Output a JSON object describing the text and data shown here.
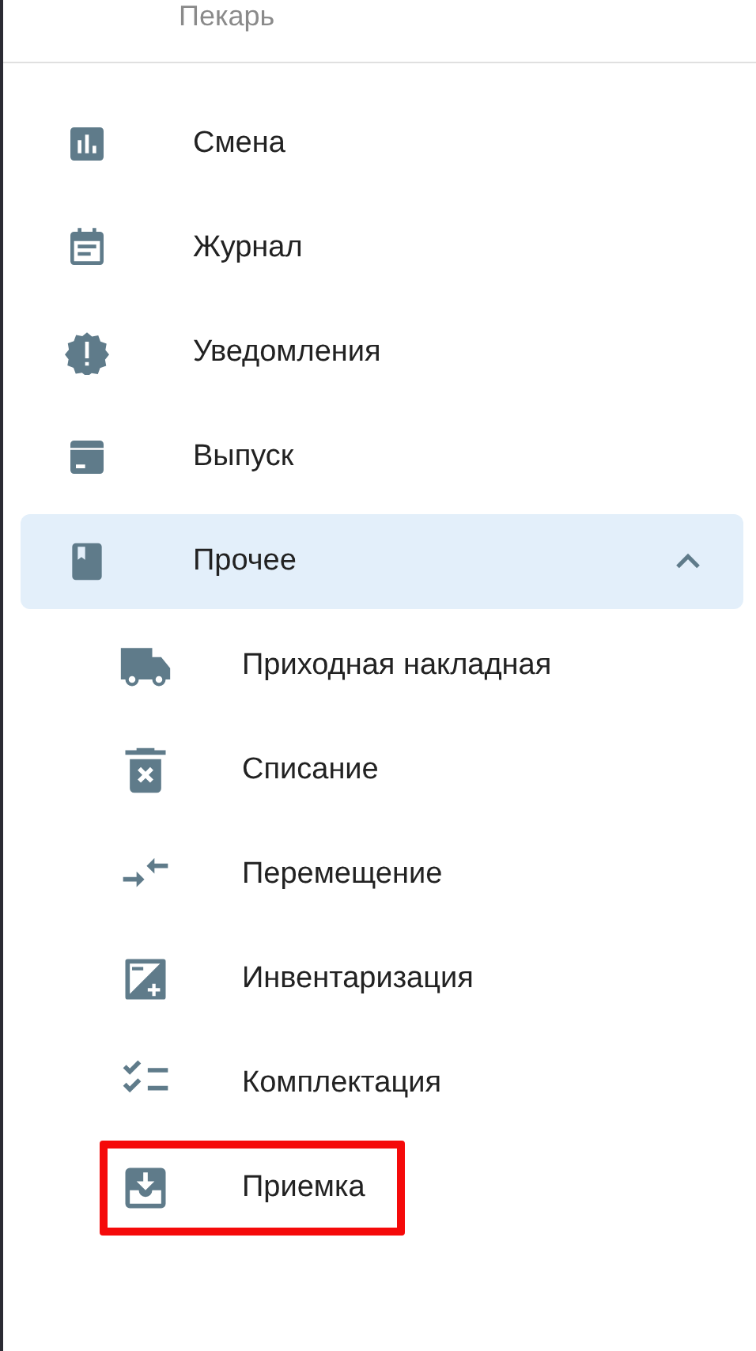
{
  "header": {
    "role": "Пекарь"
  },
  "menu": [
    {
      "label": "Смена"
    },
    {
      "label": "Журнал"
    },
    {
      "label": "Уведомления"
    },
    {
      "label": "Выпуск"
    },
    {
      "label": "Прочее",
      "expanded": true,
      "children": [
        {
          "label": "Приходная накладная",
          "highlighted": false
        },
        {
          "label": "Списание",
          "highlighted": false
        },
        {
          "label": "Перемещение",
          "highlighted": false
        },
        {
          "label": "Инвентаризация",
          "highlighted": false
        },
        {
          "label": "Комплектация",
          "highlighted": false
        },
        {
          "label": "Приемка",
          "highlighted": true
        }
      ]
    }
  ]
}
